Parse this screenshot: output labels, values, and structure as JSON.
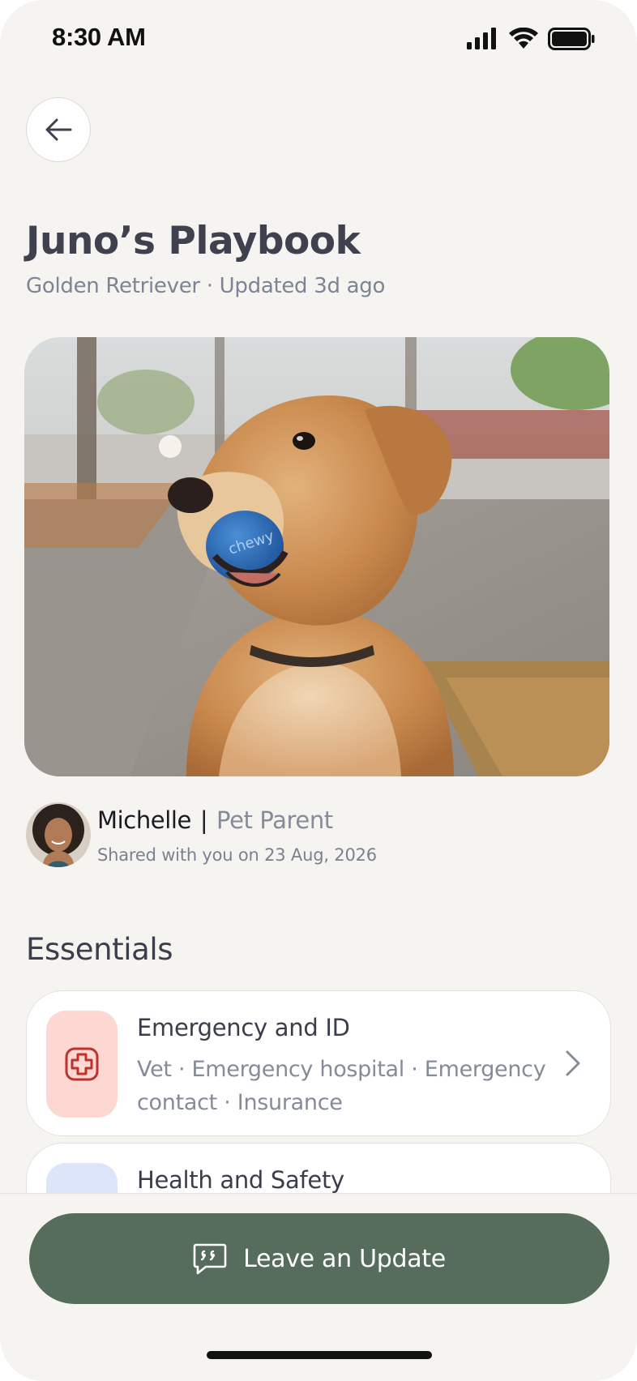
{
  "status_bar": {
    "time": "8:30 AM",
    "signal_icon": "cellular-signal-icon",
    "wifi_icon": "wifi-icon",
    "battery_icon": "battery-icon"
  },
  "header": {
    "back_icon": "arrow-left-icon",
    "title": "Juno’s Playbook",
    "subtitle": "Golden Retriever · Updated 3d ago"
  },
  "hero_image": {
    "description_icon": "dog-photo"
  },
  "owner": {
    "name": "Michelle",
    "separator": "|",
    "role": "Pet Parent",
    "shared_text": "Shared with you on 23 Aug, 2026"
  },
  "essentials": {
    "title": "Essentials",
    "cards": [
      {
        "title": "Emergency and ID",
        "description": "Vet · Emergency hospital · Emergency contact · Insurance",
        "icon": "medical-cross-icon",
        "icon_bg": "#fdd8d2",
        "icon_color": "#c0312b"
      },
      {
        "title": "Health and Safety",
        "description": "",
        "icon": "health-icon",
        "icon_bg": "#dde5fb"
      }
    ]
  },
  "cta": {
    "label": "Leave an Update",
    "icon": "quote-bubble-icon",
    "color": "#566d5c"
  },
  "colors": {
    "background": "#f5f4f0",
    "title": "#3f414f",
    "muted": "#7d8494"
  }
}
